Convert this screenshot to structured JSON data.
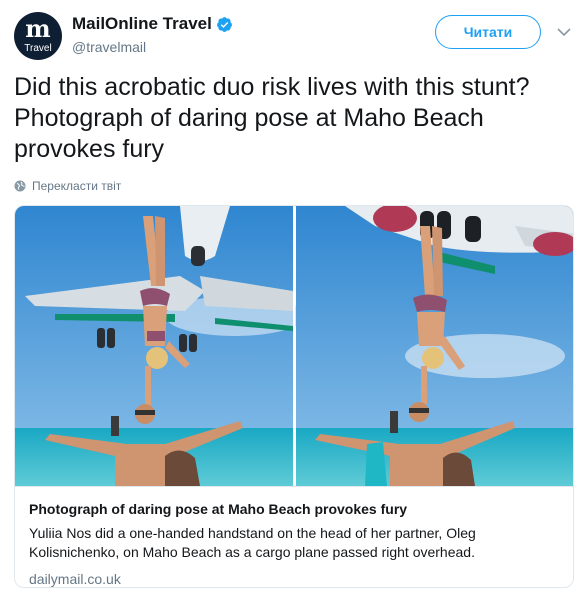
{
  "header": {
    "avatar_logo": "m",
    "avatar_subtitle": "Travel",
    "display_name": "MailOnline Travel",
    "handle": "@travelmail",
    "follow_label": "Читати",
    "verified_icon": "verified-badge-icon",
    "menu_icon": "chevron-down-icon"
  },
  "tweet": {
    "text": "Did this acrobatic duo risk lives with this stunt? Photograph of daring pose at Maho Beach provokes fury",
    "translate_label": "Перекласти твіт",
    "translate_icon": "globe-icon"
  },
  "card": {
    "image_description_icon": "photo",
    "title": "Photograph of daring pose at Maho Beach provokes fury",
    "description": "Yuliia Nos did a one-handed handstand on the head of her partner, Oleg Kolisnichenko, on Maho Beach as a cargo plane passed right overhead.",
    "domain": "dailymail.co.uk"
  },
  "colors": {
    "accent": "#1da1f2",
    "text": "#14171a",
    "secondary": "#657786",
    "border": "#e1e8ed",
    "sky": "#3b8fd4",
    "sea": "#1fa3b8"
  }
}
